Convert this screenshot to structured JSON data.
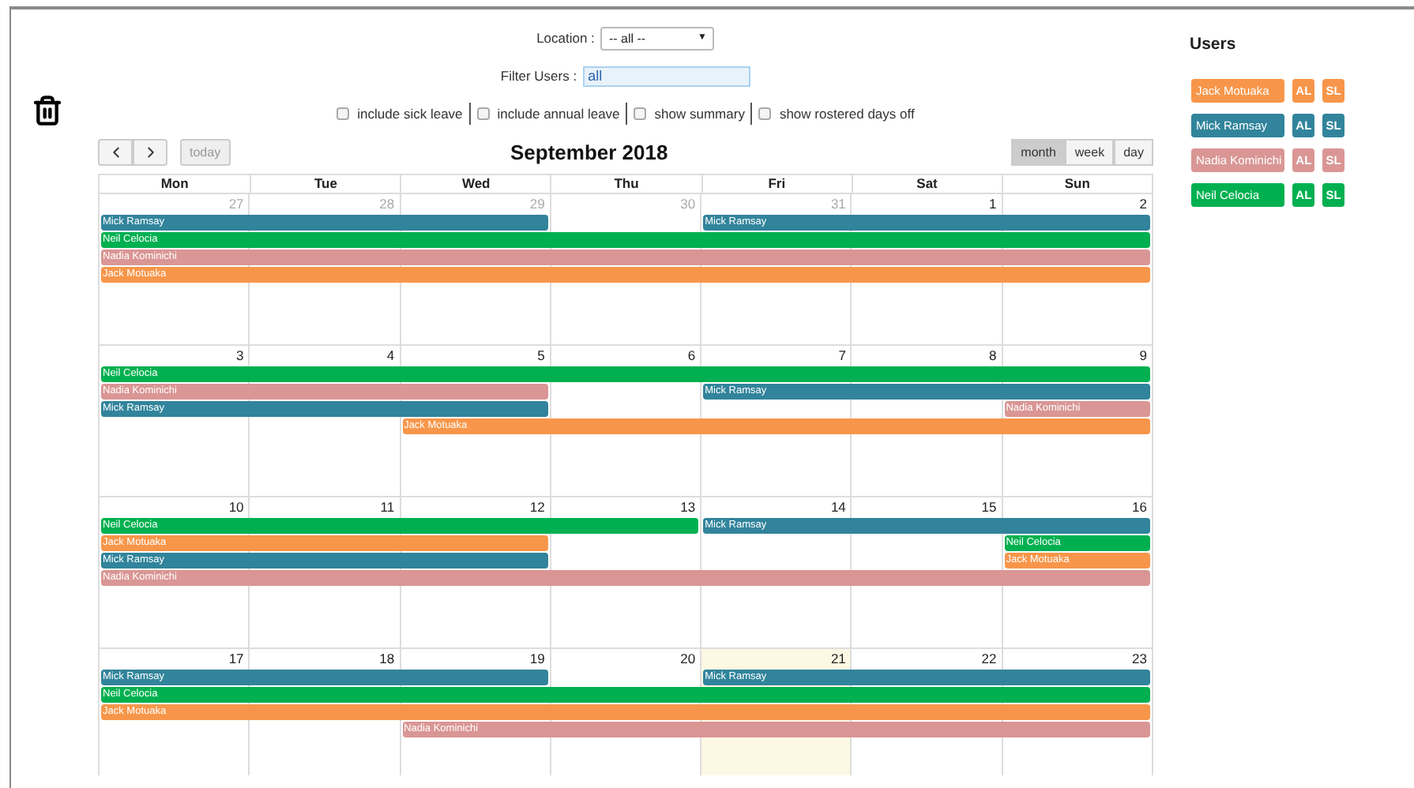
{
  "location": {
    "label": "Location :",
    "value": "-- all --",
    "arrow": "▼"
  },
  "filter": {
    "label": "Filter Users :",
    "value": "all"
  },
  "options": [
    {
      "label": "include sick leave",
      "checked": false
    },
    {
      "label": "include annual leave",
      "checked": false
    },
    {
      "label": "show summary",
      "checked": false
    },
    {
      "label": "show rostered days off",
      "checked": false
    }
  ],
  "today_button": {
    "label": "today",
    "disabled": true
  },
  "title": "September 2018",
  "views": [
    {
      "label": "month",
      "selected": true
    },
    {
      "label": "week",
      "selected": false
    },
    {
      "label": "day",
      "selected": false
    }
  ],
  "weekdays": [
    "Mon",
    "Tue",
    "Wed",
    "Thu",
    "Fri",
    "Sat",
    "Sun"
  ],
  "weeks": [
    {
      "days": [
        {
          "label": "27",
          "other_month": true,
          "today": false
        },
        {
          "label": "28",
          "other_month": true,
          "today": false
        },
        {
          "label": "29",
          "other_month": true,
          "today": false
        },
        {
          "label": "30",
          "other_month": true,
          "today": false
        },
        {
          "label": "31",
          "other_month": true,
          "today": false
        },
        {
          "label": "1",
          "other_month": false,
          "today": false
        },
        {
          "label": "2",
          "other_month": false,
          "today": false
        }
      ],
      "lanes": [
        [
          {
            "kind": "start",
            "name": "Mick Ramsay",
            "color": "#31849b"
          },
          {
            "kind": "continue"
          },
          {
            "kind": "continue"
          },
          {
            "kind": "empty"
          },
          {
            "kind": "start",
            "name": "Mick Ramsay",
            "color": "#31849b"
          },
          {
            "kind": "continue"
          },
          {
            "kind": "continue"
          }
        ],
        [
          {
            "kind": "start",
            "name": "Neil Celocia",
            "color": "#00b050"
          },
          {
            "kind": "continue"
          },
          {
            "kind": "continue"
          },
          {
            "kind": "continue"
          },
          {
            "kind": "continue"
          },
          {
            "kind": "continue"
          },
          {
            "kind": "continue"
          }
        ],
        [
          {
            "kind": "start",
            "name": "Nadia Kominichi",
            "color": "#d99694"
          },
          {
            "kind": "continue"
          },
          {
            "kind": "continue"
          },
          {
            "kind": "continue"
          },
          {
            "kind": "continue"
          },
          {
            "kind": "continue"
          },
          {
            "kind": "continue"
          }
        ],
        [
          {
            "kind": "start",
            "name": "Jack Motuaka",
            "color": "#f7964a"
          },
          {
            "kind": "continue"
          },
          {
            "kind": "continue"
          },
          {
            "kind": "continue"
          },
          {
            "kind": "continue"
          },
          {
            "kind": "continue"
          },
          {
            "kind": "continue"
          }
        ]
      ]
    },
    {
      "days": [
        {
          "label": "3",
          "other_month": false,
          "today": false
        },
        {
          "label": "4",
          "other_month": false,
          "today": false
        },
        {
          "label": "5",
          "other_month": false,
          "today": false
        },
        {
          "label": "6",
          "other_month": false,
          "today": false
        },
        {
          "label": "7",
          "other_month": false,
          "today": false
        },
        {
          "label": "8",
          "other_month": false,
          "today": false
        },
        {
          "label": "9",
          "other_month": false,
          "today": false
        }
      ],
      "lanes": [
        [
          {
            "kind": "start",
            "name": "Neil Celocia",
            "color": "#00b050"
          },
          {
            "kind": "continue"
          },
          {
            "kind": "continue"
          },
          {
            "kind": "continue"
          },
          {
            "kind": "continue"
          },
          {
            "kind": "continue"
          },
          {
            "kind": "continue"
          }
        ],
        [
          {
            "kind": "start",
            "name": "Nadia Kominichi",
            "color": "#d99694"
          },
          {
            "kind": "continue"
          },
          {
            "kind": "continue"
          },
          {
            "kind": "empty"
          },
          {
            "kind": "start",
            "name": "Mick Ramsay",
            "color": "#31849b"
          },
          {
            "kind": "continue"
          },
          {
            "kind": "continue"
          }
        ],
        [
          {
            "kind": "start",
            "name": "Mick Ramsay",
            "color": "#31849b"
          },
          {
            "kind": "continue"
          },
          {
            "kind": "continue"
          },
          {
            "kind": "empty"
          },
          {
            "kind": "empty"
          },
          {
            "kind": "empty"
          },
          {
            "kind": "start",
            "name": "Nadia Kominichi",
            "color": "#d99694"
          }
        ],
        [
          {
            "kind": "empty"
          },
          {
            "kind": "empty"
          },
          {
            "kind": "start",
            "name": "Jack Motuaka",
            "color": "#f7964a"
          },
          {
            "kind": "continue"
          },
          {
            "kind": "continue"
          },
          {
            "kind": "continue"
          },
          {
            "kind": "continue"
          }
        ]
      ]
    },
    {
      "days": [
        {
          "label": "10",
          "other_month": false,
          "today": false
        },
        {
          "label": "11",
          "other_month": false,
          "today": false
        },
        {
          "label": "12",
          "other_month": false,
          "today": false
        },
        {
          "label": "13",
          "other_month": false,
          "today": false
        },
        {
          "label": "14",
          "other_month": false,
          "today": false
        },
        {
          "label": "15",
          "other_month": false,
          "today": false
        },
        {
          "label": "16",
          "other_month": false,
          "today": false
        }
      ],
      "lanes": [
        [
          {
            "kind": "start",
            "name": "Neil Celocia",
            "color": "#00b050"
          },
          {
            "kind": "continue"
          },
          {
            "kind": "continue"
          },
          {
            "kind": "continue"
          },
          {
            "kind": "start",
            "name": "Mick Ramsay",
            "color": "#31849b"
          },
          {
            "kind": "continue"
          },
          {
            "kind": "continue"
          }
        ],
        [
          {
            "kind": "start",
            "name": "Jack Motuaka",
            "color": "#f7964a"
          },
          {
            "kind": "continue"
          },
          {
            "kind": "continue"
          },
          {
            "kind": "empty"
          },
          {
            "kind": "empty"
          },
          {
            "kind": "empty"
          },
          {
            "kind": "start",
            "name": "Neil Celocia",
            "color": "#00b050"
          }
        ],
        [
          {
            "kind": "start",
            "name": "Mick Ramsay",
            "color": "#31849b"
          },
          {
            "kind": "continue"
          },
          {
            "kind": "continue"
          },
          {
            "kind": "empty"
          },
          {
            "kind": "empty"
          },
          {
            "kind": "empty"
          },
          {
            "kind": "start",
            "name": "Jack Motuaka",
            "color": "#f7964a"
          }
        ],
        [
          {
            "kind": "start",
            "name": "Nadia Kominichi",
            "color": "#d99694"
          },
          {
            "kind": "continue"
          },
          {
            "kind": "continue"
          },
          {
            "kind": "continue"
          },
          {
            "kind": "continue"
          },
          {
            "kind": "continue"
          },
          {
            "kind": "continue"
          }
        ]
      ]
    },
    {
      "days": [
        {
          "label": "17",
          "other_month": false,
          "today": false
        },
        {
          "label": "18",
          "other_month": false,
          "today": false
        },
        {
          "label": "19",
          "other_month": false,
          "today": false
        },
        {
          "label": "20",
          "other_month": false,
          "today": false
        },
        {
          "label": "21",
          "other_month": false,
          "today": true
        },
        {
          "label": "22",
          "other_month": false,
          "today": false
        },
        {
          "label": "23",
          "other_month": false,
          "today": false
        }
      ],
      "lanes": [
        [
          {
            "kind": "start",
            "name": "Mick Ramsay",
            "color": "#31849b"
          },
          {
            "kind": "continue"
          },
          {
            "kind": "continue"
          },
          {
            "kind": "empty"
          },
          {
            "kind": "start",
            "name": "Mick Ramsay",
            "color": "#31849b"
          },
          {
            "kind": "continue"
          },
          {
            "kind": "continue"
          }
        ],
        [
          {
            "kind": "start",
            "name": "Neil Celocia",
            "color": "#00b050"
          },
          {
            "kind": "continue"
          },
          {
            "kind": "continue"
          },
          {
            "kind": "continue"
          },
          {
            "kind": "continue"
          },
          {
            "kind": "continue"
          },
          {
            "kind": "continue"
          }
        ],
        [
          {
            "kind": "start",
            "name": "Jack Motuaka",
            "color": "#f7964a"
          },
          {
            "kind": "continue"
          },
          {
            "kind": "continue"
          },
          {
            "kind": "continue"
          },
          {
            "kind": "continue"
          },
          {
            "kind": "continue"
          },
          {
            "kind": "continue"
          }
        ],
        [
          {
            "kind": "empty"
          },
          {
            "kind": "empty"
          },
          {
            "kind": "start",
            "name": "Nadia Kominichi",
            "color": "#d99694"
          },
          {
            "kind": "continue"
          },
          {
            "kind": "continue"
          },
          {
            "kind": "continue"
          },
          {
            "kind": "continue"
          }
        ]
      ]
    }
  ],
  "users": {
    "title": "Users",
    "items": [
      {
        "name": "Jack Motuaka",
        "color": "#f7964a",
        "buttons": [
          "AL",
          "SL"
        ]
      },
      {
        "name": "Mick Ramsay",
        "color": "#31849b",
        "buttons": [
          "AL",
          "SL"
        ]
      },
      {
        "name": "Nadia Kominichi",
        "color": "#d99694",
        "buttons": [
          "AL",
          "SL"
        ]
      },
      {
        "name": "Neil Celocia",
        "color": "#00b050",
        "buttons": [
          "AL",
          "SL"
        ]
      }
    ]
  }
}
